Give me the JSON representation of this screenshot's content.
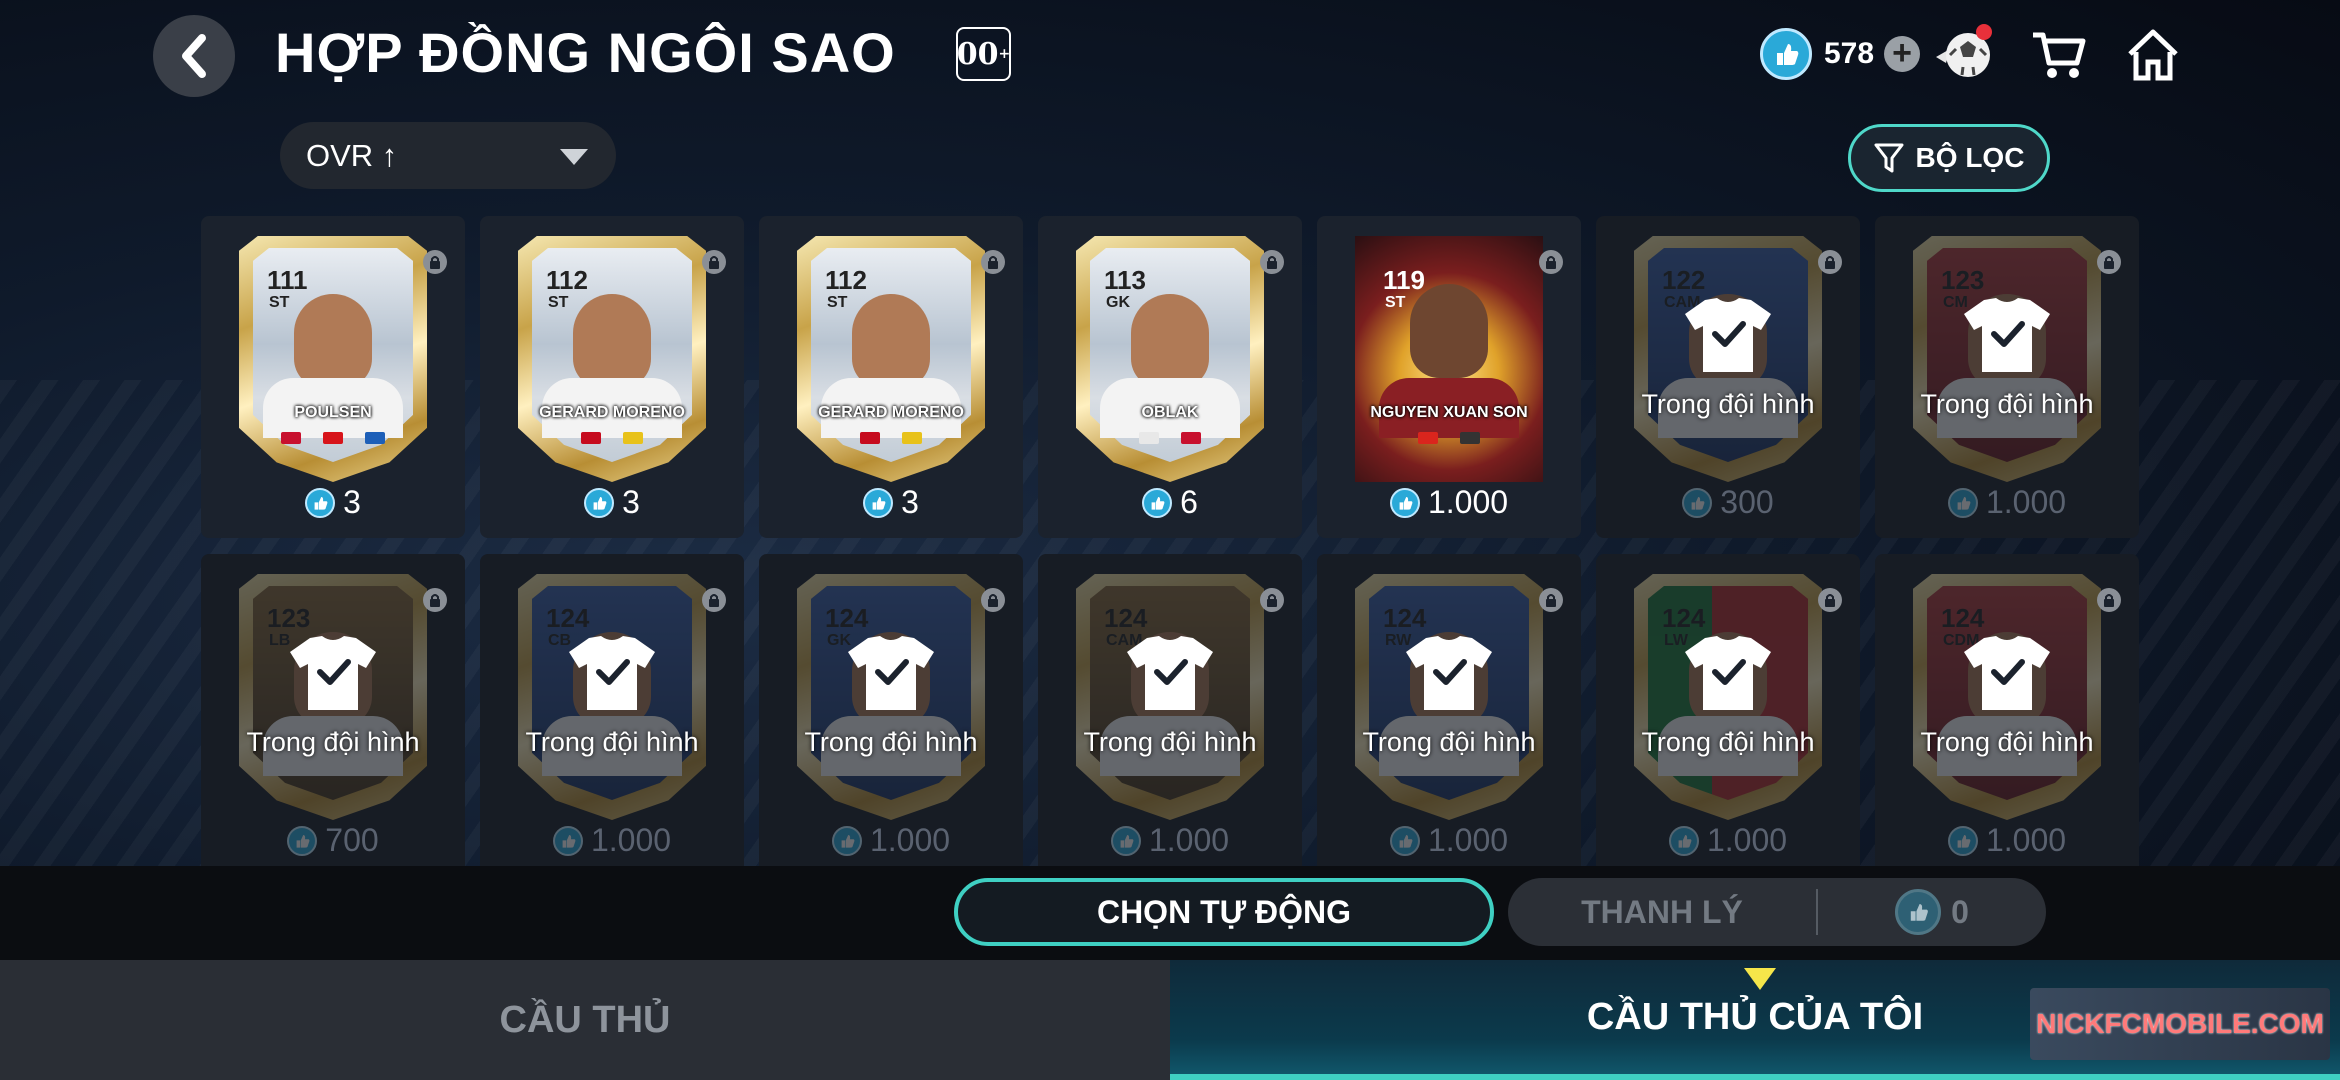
{
  "header": {
    "title": "HỢP ĐỒNG NGÔI SAO",
    "badge": "00",
    "currency_value": "578"
  },
  "sort": {
    "label": "OVR ↑"
  },
  "filter": {
    "label": "BỘ LỌC"
  },
  "overlay_label": "Trong đội hình",
  "players": [
    {
      "ovr": "111",
      "pos": "ST",
      "name": "POULSEN",
      "price": "3",
      "in_squad": false,
      "style": "gold"
    },
    {
      "ovr": "112",
      "pos": "ST",
      "name": "GERARD MORENO",
      "price": "3",
      "in_squad": false,
      "style": "gold"
    },
    {
      "ovr": "112",
      "pos": "ST",
      "name": "GERARD MORENO",
      "price": "3",
      "in_squad": false,
      "style": "gold"
    },
    {
      "ovr": "113",
      "pos": "GK",
      "name": "OBLAK",
      "price": "6",
      "in_squad": false,
      "style": "gold"
    },
    {
      "ovr": "119",
      "pos": "ST",
      "name": "NGUYEN XUAN SON",
      "price": "1.000",
      "in_squad": false,
      "style": "star"
    },
    {
      "ovr": "122",
      "pos": "CAM",
      "name": "",
      "price": "300",
      "in_squad": true,
      "style": "blue"
    },
    {
      "ovr": "123",
      "pos": "CM",
      "name": "",
      "price": "1.000",
      "in_squad": true,
      "style": "red"
    },
    {
      "ovr": "123",
      "pos": "LB",
      "name": "",
      "price": "700",
      "in_squad": true,
      "style": "brown"
    },
    {
      "ovr": "124",
      "pos": "CB",
      "name": "",
      "price": "1.000",
      "in_squad": true,
      "style": "blue"
    },
    {
      "ovr": "124",
      "pos": "GK",
      "name": "",
      "price": "1.000",
      "in_squad": true,
      "style": "blue"
    },
    {
      "ovr": "124",
      "pos": "CAM",
      "name": "",
      "price": "1.000",
      "in_squad": true,
      "style": "brown"
    },
    {
      "ovr": "124",
      "pos": "RW",
      "name": "",
      "price": "1.000",
      "in_squad": true,
      "style": "blue"
    },
    {
      "ovr": "124",
      "pos": "LW",
      "name": "",
      "price": "1.000",
      "in_squad": true,
      "style": "green"
    },
    {
      "ovr": "124",
      "pos": "CDM",
      "name": "",
      "price": "1.000",
      "in_squad": true,
      "style": "red"
    }
  ],
  "actions": {
    "auto_select": "CHỌN TỰ ĐỘNG",
    "sell": "THANH LÝ",
    "sell_value": "0"
  },
  "tabs": {
    "players": "CẦU THỦ",
    "my_players": "CẦU THỦ CỦA TÔI"
  },
  "watermark": "NICKFCMOBILE.COM",
  "colors": {
    "accent": "#3fd0c3",
    "coin": "#2aa9d8",
    "notification": "#e8303a"
  }
}
